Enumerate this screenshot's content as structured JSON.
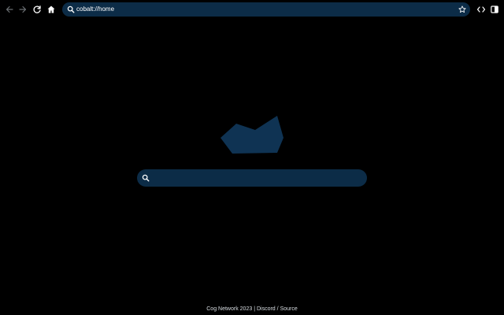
{
  "toolbar": {
    "url": "cobalt://home"
  },
  "home": {
    "search_placeholder": ""
  },
  "footer": {
    "brand": "Cog Network 2023",
    "separator": "|",
    "discord": "Discord",
    "slash": "/",
    "source": "Source"
  },
  "icons": {
    "back": "arrow-left-icon",
    "forward": "arrow-right-icon",
    "reload": "reload-icon",
    "home": "home-icon",
    "search": "search-icon",
    "bookmark": "star-icon",
    "devtools": "code-icon",
    "sidebar": "sidebar-icon",
    "logo": "cobalt-logo"
  },
  "colors": {
    "background": "#000000",
    "accent": "#0c2c47",
    "logo": "#0f3353",
    "text": "#ffffff"
  }
}
